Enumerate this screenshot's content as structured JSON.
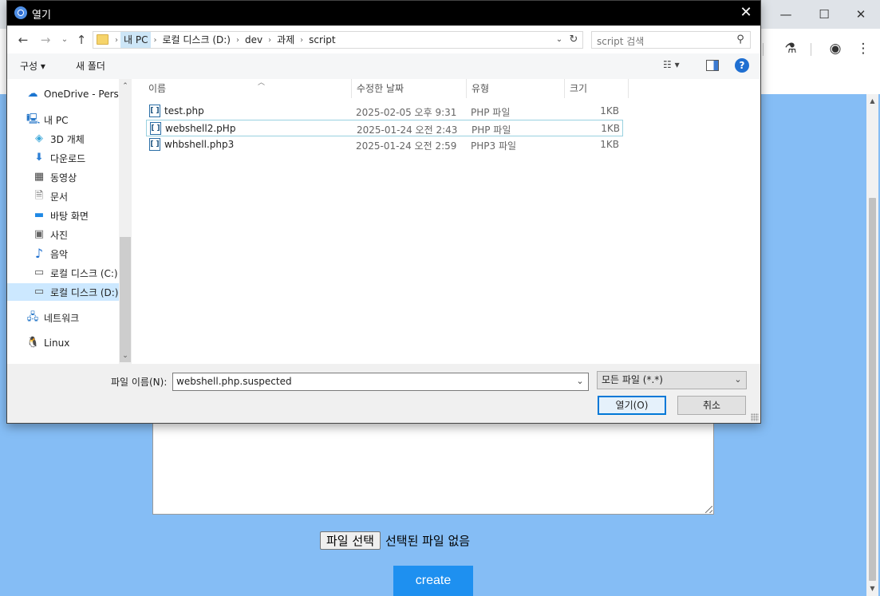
{
  "dialog": {
    "title": "열기",
    "address": {
      "crumbs": [
        "내 PC",
        "로컬 디스크 (D:)",
        "dev",
        "과제",
        "script"
      ]
    },
    "search": {
      "placeholder": "script 검색"
    },
    "toolbar": {
      "organize_label": "구성 ▾",
      "new_folder_label": "새 폴더",
      "view_label": "☷ ▾",
      "help_label": "?"
    },
    "nav_items": [
      {
        "label": "OneDrive - Person",
        "icon": "cloud-icon"
      },
      {
        "label": "내 PC",
        "icon": "computer-icon"
      },
      {
        "label": "3D 개체",
        "icon": "3d-objects-icon"
      },
      {
        "label": "다운로드",
        "icon": "download-icon"
      },
      {
        "label": "동영상",
        "icon": "video-icon"
      },
      {
        "label": "문서",
        "icon": "document-icon"
      },
      {
        "label": "바탕 화면",
        "icon": "desktop-icon"
      },
      {
        "label": "사진",
        "icon": "picture-icon"
      },
      {
        "label": "음악",
        "icon": "music-icon"
      },
      {
        "label": "로컬 디스크 (C:)",
        "icon": "drive-icon"
      },
      {
        "label": "로컬 디스크 (D:)",
        "icon": "drive-icon",
        "selected": true
      },
      {
        "label": "네트워크",
        "icon": "network-icon"
      },
      {
        "label": "Linux",
        "icon": "linux-penguin-icon"
      }
    ],
    "columns": {
      "name": "이름",
      "date": "수정한 날짜",
      "type": "유형",
      "size": "크기"
    },
    "files": [
      {
        "name": "test.php",
        "date": "2025-02-05 오후 9:31",
        "type": "PHP 파일",
        "size": "1KB"
      },
      {
        "name": "webshell2.pHp",
        "date": "2025-01-24 오전 2:43",
        "type": "PHP 파일",
        "size": "1KB",
        "focused": true
      },
      {
        "name": "whbshell.php3",
        "date": "2025-01-24 오전 2:59",
        "type": "PHP3 파일",
        "size": "1KB"
      }
    ],
    "filename_label": "파일 이름(N):",
    "filename_value": "webshell.php.suspected",
    "filetype_value": "모든 파일 (*.*)",
    "open_label": "열기(O)",
    "cancel_label": "취소"
  },
  "page": {
    "file_choose_label": "파일 선택",
    "file_status": "선택된 파일 없음",
    "create_label": "create"
  },
  "colors": {
    "page_background": "#85bdf5",
    "create_button": "#1e90f0",
    "dialog_title_bar": "#000000",
    "selection": "#cce8ff"
  }
}
